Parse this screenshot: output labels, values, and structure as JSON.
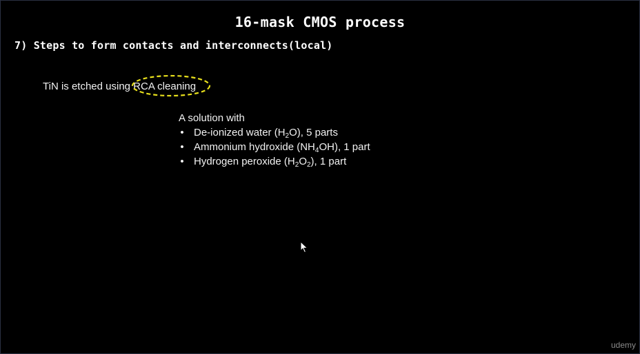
{
  "slide": {
    "title": "16-mask CMOS process",
    "heading": "7) Steps to form contacts and interconnects(local)",
    "etch_prefix": "TiN is etched using ",
    "etch_highlight": "RCA cleaning",
    "highlight_color": "#e8e01c",
    "solution_intro": "A solution with",
    "bullets": [
      {
        "pre": "De-ionized water (H",
        "sub1": "2",
        "mid": "O), 5 parts",
        "sub2": "",
        "post": ""
      },
      {
        "pre": "Ammonium hydroxide (NH",
        "sub1": "4",
        "mid": "OH), 1 part",
        "sub2": "",
        "post": ""
      },
      {
        "pre": "Hydrogen peroxide (H",
        "sub1": "2",
        "mid": "O",
        "sub2": "2",
        "post": "), 1 part"
      }
    ],
    "bullet_glyph": "•"
  },
  "watermark": "udemy"
}
